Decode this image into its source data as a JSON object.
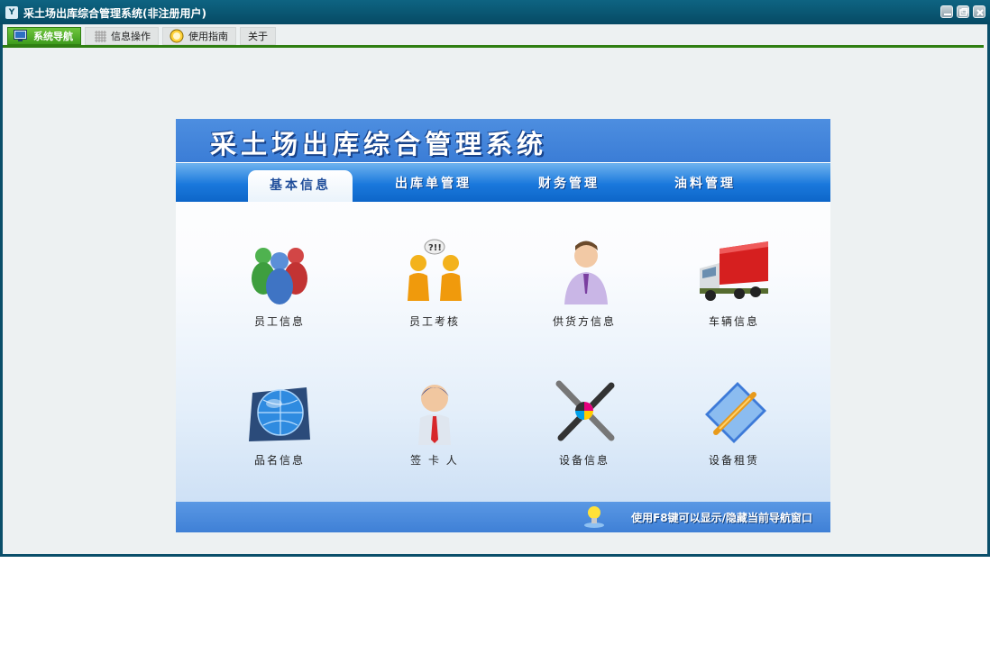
{
  "window": {
    "title": "采土场出库综合管理系统(非注册用户)",
    "icon_text": "Y"
  },
  "tabs": [
    {
      "label": "系统导航",
      "icon": "monitor-icon",
      "active": true
    },
    {
      "label": "信息操作",
      "icon": "grid-icon",
      "active": false
    },
    {
      "label": "使用指南",
      "icon": "help-icon",
      "active": false
    },
    {
      "label": "关于",
      "icon": "",
      "active": false
    }
  ],
  "panel": {
    "title": "采土场出库综合管理系统",
    "nav": [
      {
        "label": "基本信息",
        "selected": true
      },
      {
        "label": "出库单管理",
        "selected": false
      },
      {
        "label": "财务管理",
        "selected": false
      },
      {
        "label": "油料管理",
        "selected": false
      }
    ],
    "items": [
      {
        "label": "员工信息",
        "icon": "employees-icon"
      },
      {
        "label": "员工考核",
        "icon": "assessment-icon"
      },
      {
        "label": "供货方信息",
        "icon": "supplier-icon"
      },
      {
        "label": "车辆信息",
        "icon": "truck-icon"
      },
      {
        "label": "品名信息",
        "icon": "globe-icon"
      },
      {
        "label": "签 卡 人",
        "icon": "signer-icon"
      },
      {
        "label": "设备信息",
        "icon": "tools-icon"
      },
      {
        "label": "设备租赁",
        "icon": "rental-icon"
      }
    ],
    "hint": "使用F8键可以显示/隐藏当前导航窗口"
  },
  "colors": {
    "titlebar": "#0a4f6a",
    "active_tab": "#3d9b1c",
    "banner": "#3b7dd6"
  }
}
